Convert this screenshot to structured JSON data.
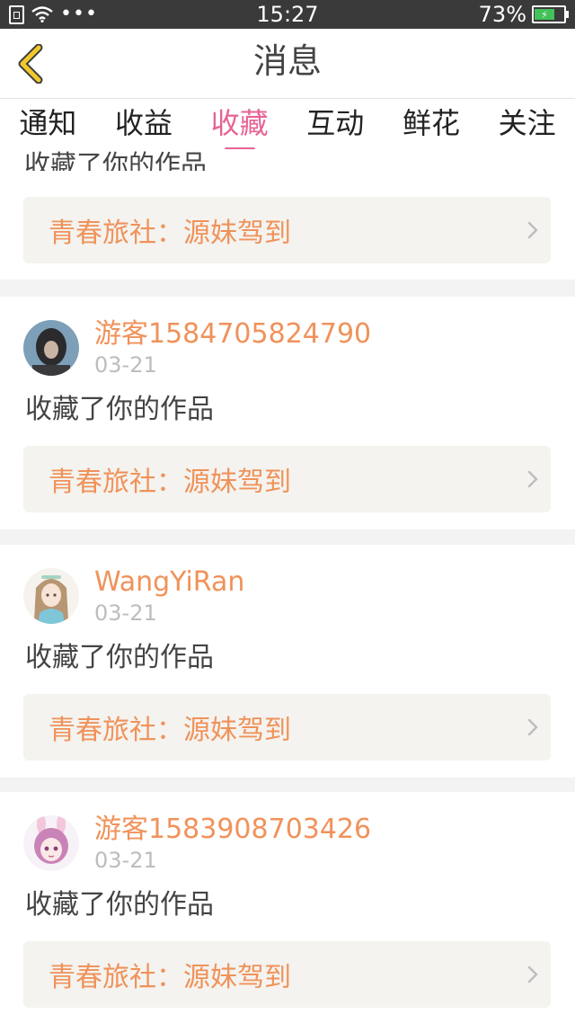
{
  "status_bar": {
    "time": "15:27",
    "battery_percent": "73%",
    "battery_level": 0.73
  },
  "nav": {
    "title": "消息",
    "back_icon": "chevron-left-icon"
  },
  "tabs": [
    {
      "label": "通知",
      "active": false
    },
    {
      "label": "收益",
      "active": false
    },
    {
      "label": "收藏",
      "active": true
    },
    {
      "label": "互动",
      "active": false
    },
    {
      "label": "鲜花",
      "active": false
    },
    {
      "label": "关注",
      "active": false
    }
  ],
  "feed": {
    "partial_item": {
      "action": "收藏了你的作品",
      "work_title": "青春旅社：源妹驾到"
    },
    "items": [
      {
        "user": "游客1584705824790",
        "date": "03-21",
        "action": "收藏了你的作品",
        "work_title": "青春旅社：源妹驾到",
        "avatar": "dark-hair-avatar"
      },
      {
        "user": "WangYiRan",
        "date": "03-21",
        "action": "收藏了你的作品",
        "work_title": "青春旅社：源妹驾到",
        "avatar": "anime-girl-avatar"
      },
      {
        "user": "游客1583908703426",
        "date": "03-21",
        "action": "收藏了你的作品",
        "work_title": "青春旅社：源妹驾到",
        "avatar": "pink-bunny-avatar"
      }
    ]
  },
  "colors": {
    "accent_pink": "#e66495",
    "orange_text": "#f0925a",
    "back_icon_yellow": "#f2c92c"
  }
}
